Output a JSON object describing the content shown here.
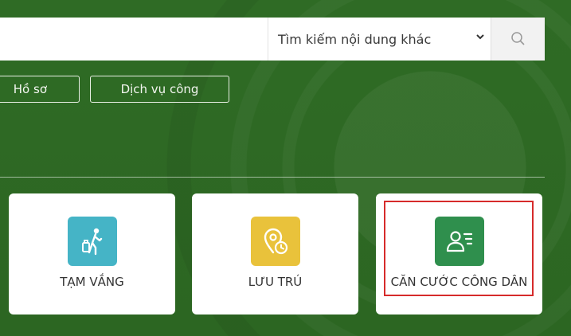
{
  "search": {
    "input_value": "",
    "select_value": "Tìm kiếm nội dung khác"
  },
  "pills": {
    "p1": "Hồ sơ",
    "p2": "Dịch vụ công"
  },
  "cards": [
    {
      "label": "TẠM VẮNG",
      "icon": "person-walking-luggage-icon",
      "color": "#45b4c6"
    },
    {
      "label": "LƯU TRÚ",
      "icon": "location-clock-icon",
      "color": "#e9c23b"
    },
    {
      "label": "CĂN CƯỚC CÔNG DÂN",
      "icon": "id-card-icon",
      "color": "#2f8f4d"
    }
  ],
  "colors": {
    "background": "#2e6a24",
    "highlight": "#d62b2b"
  }
}
